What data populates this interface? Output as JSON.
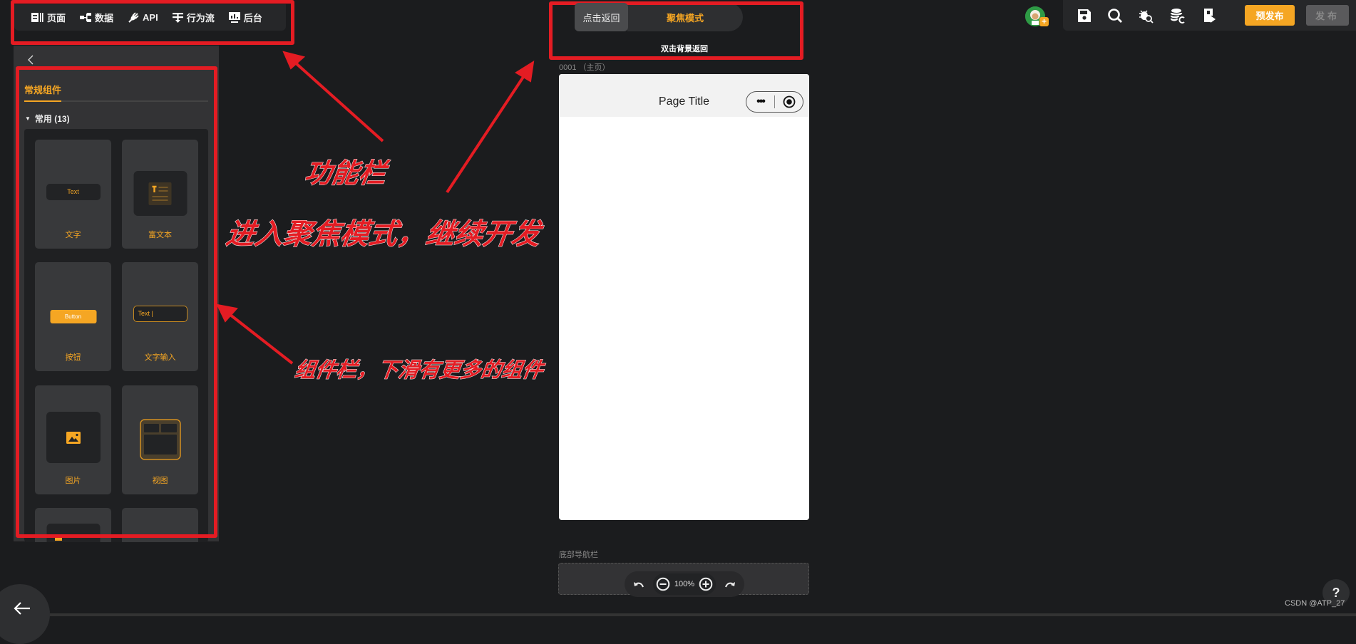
{
  "topbar": {
    "items": [
      {
        "label": "页面",
        "icon": "page-icon"
      },
      {
        "label": "数据",
        "icon": "data-tree-icon"
      },
      {
        "label": "API",
        "icon": "plug-icon"
      },
      {
        "label": "行为流",
        "icon": "flow-icon"
      },
      {
        "label": "后台",
        "icon": "dashboard-icon"
      }
    ]
  },
  "left_panel": {
    "tab": "常规组件",
    "group": "常用 (13)",
    "components": [
      {
        "label": "文字",
        "preview": "Text"
      },
      {
        "label": "富文本",
        "preview": "rich-text-icon"
      },
      {
        "label": "按钮",
        "preview": "Button"
      },
      {
        "label": "文字输入",
        "preview": "Text |"
      },
      {
        "label": "图片",
        "preview": "image-icon"
      },
      {
        "label": "视图",
        "preview": "view-icon"
      }
    ]
  },
  "focus": {
    "back_label": "点击返回",
    "mode_label": "聚焦模式",
    "hint": "双击背景返回"
  },
  "canvas": {
    "page_label": "0001 （主页）",
    "page_title": "Page Title",
    "capsule_more": "•••",
    "tabbar_label": "底部导航栏",
    "zoom": "100%"
  },
  "toolbar": {
    "prepublish": "预发布",
    "publish": "发布"
  },
  "footer": {
    "help": "?",
    "watermark": "CSDN @ATP_27"
  },
  "annotations": {
    "function_bar": "功能栏",
    "focus_mode": "进入聚焦模式，继续开发",
    "component_bar": "组件栏，下滑有更多的组件"
  },
  "colors": {
    "accent": "#f5a623",
    "annotation_red": "#e41c23",
    "background": "#1b1c1e"
  }
}
